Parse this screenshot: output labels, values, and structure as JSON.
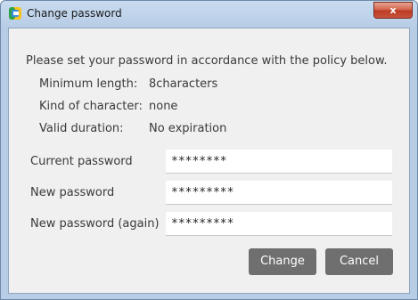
{
  "window": {
    "title": "Change password",
    "close_label": "x"
  },
  "policy": {
    "intro": "Please set your password in accordance with the policy below.",
    "items": [
      {
        "label": "Minimum length:",
        "value": "8characters"
      },
      {
        "label": "Kind of character:",
        "value": "none"
      },
      {
        "label": "Valid duration:",
        "value": "No expiration"
      }
    ]
  },
  "form": {
    "current": {
      "label": "Current password",
      "value": "********"
    },
    "new": {
      "label": "New password",
      "value": "*********"
    },
    "again": {
      "label": "New password (again)",
      "value": "*********"
    }
  },
  "buttons": {
    "change": "Change",
    "cancel": "Cancel"
  },
  "colors": {
    "button_bg": "#6f6f6f",
    "dialog_bg": "#f0f0f0",
    "titlebar": "#b7cde6",
    "close_button": "#c8533b"
  },
  "icons": [
    "app-logo-icon",
    "close-icon"
  ]
}
